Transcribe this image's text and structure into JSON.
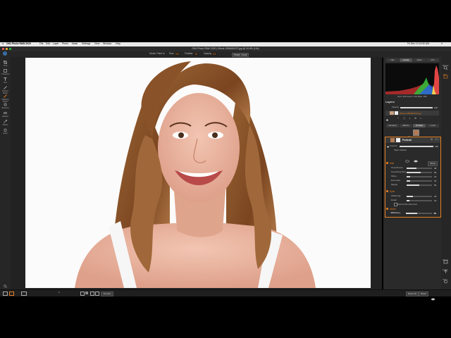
{
  "menubar": {
    "app": "ON1 Photo RAW 2020",
    "items": [
      "File",
      "Edit",
      "Layer",
      "Photo",
      "Mask",
      "Settings",
      "View",
      "Window",
      "Help"
    ],
    "status": "Fri Dec 13  10:30 AM"
  },
  "window": {
    "title": "ON1 Photo RAW 2020 | iStock-1056663472.jpg @ 34.8% (144)"
  },
  "options": {
    "mode_label": "Mode: Paint In",
    "size_label": "Size",
    "size_value": "150",
    "feather_label": "Feather",
    "feather_value": "50",
    "opacity_label": "Opacity",
    "opacity_value": "100",
    "reset_label": "Reset",
    "done_label": "Done"
  },
  "tools": [
    "Crop",
    "Transform",
    "Text",
    "Perfect Brush",
    "Masking Brush",
    "Retouch",
    "Redeye",
    "Refine",
    "Hand"
  ],
  "panel": {
    "tabs": [
      "Nav",
      "Levels",
      "Histo",
      "Info"
    ],
    "histogram_readout": "Red: 226  Green: 241  Blue: 255",
    "layers_title": "Layers",
    "opacity_label": "Opacity",
    "opacity_value": "100",
    "layer_name": "iStock-1056663472.jpg",
    "subtabs": [
      "Develop",
      "Effects",
      "Portrait",
      "Local"
    ],
    "portrait_title": "Portrait",
    "amount_label": "Amount",
    "amount_value": "100",
    "style_label": "Style: Default",
    "skin_label": "Skin",
    "skin_button": "Show",
    "skin_sliders": [
      {
        "label": "Smoothness",
        "value": "39"
      },
      {
        "label": "Smoothing Size",
        "value": "56"
      },
      {
        "label": "Shine",
        "value": "15"
      },
      {
        "label": "Evenness",
        "value": "15"
      },
      {
        "label": "Margin",
        "value": "50"
      }
    ],
    "eyes_label": "Eyes",
    "eye_sliders": [
      {
        "label": "Whitening",
        "value": "25"
      },
      {
        "label": "Detail",
        "value": "10"
      }
    ],
    "dark_circles_label": "Dark Circle Removal",
    "mouth_label": "Mouth",
    "mouth_sliders": [
      {
        "label": "Whitening",
        "value": "55"
      },
      {
        "label": "Vibrance",
        "value": "45"
      }
    ]
  },
  "right_tools": [
    "Browse",
    "Edit",
    "Resize",
    "Export",
    "Share"
  ],
  "bottom": {
    "preview_label": "Preview",
    "reset_all": "Reset All",
    "reset": "Reset"
  },
  "colors": {
    "accent": "#e67e22",
    "panel_bg": "#2a2a2a",
    "canvas_bg": "#222222"
  }
}
